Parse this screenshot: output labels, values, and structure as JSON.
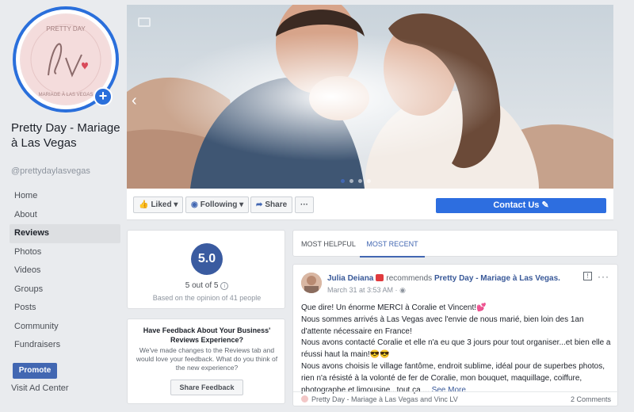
{
  "page": {
    "name": "Pretty Day - Mariage à Las Vegas",
    "handle": "@prettydaylasvegas",
    "logo_text": {
      "top": "PRETTY DAY",
      "monogram": "LV",
      "bottom": "MARIAGE À LAS VEGAS"
    }
  },
  "sidebar": {
    "items": [
      {
        "label": "Home"
      },
      {
        "label": "About"
      },
      {
        "label": "Reviews",
        "active": true
      },
      {
        "label": "Photos"
      },
      {
        "label": "Videos"
      },
      {
        "label": "Groups"
      },
      {
        "label": "Posts"
      },
      {
        "label": "Community"
      },
      {
        "label": "Fundraisers"
      }
    ],
    "promote_label": "Promote",
    "visit_ad_center": "Visit Ad Center"
  },
  "actions": {
    "liked": "Liked",
    "following": "Following",
    "share": "Share",
    "more": "···",
    "contact": "Contact Us"
  },
  "rating": {
    "score": "5.0",
    "out_of": "5 out of 5",
    "basis": "Based on the opinion of 41 people"
  },
  "feedback": {
    "title": "Have Feedback About Your Business' Reviews Experience?",
    "body": "We've made changes to the Reviews tab and would love your feedback. What do you think of the new experience?",
    "button": "Share Feedback"
  },
  "tabs": [
    {
      "label": "MOST HELPFUL",
      "active": false
    },
    {
      "label": "MOST RECENT",
      "active": true
    }
  ],
  "review": {
    "author": "Julia Deiana",
    "verb": "recommends",
    "target": "Pretty Day - Mariage à Las Vegas.",
    "time": "March 31 at 3:53 AM ·",
    "lines": [
      "Que dire! Un énorme MERCI à Coralie et Vincent!💕",
      "Nous sommes arrivés à Las Vegas avec l'envie de nous marié, bien loin des 1an d'attente nécessaire en France!",
      "Nous avons contacté Coralie et elle n'a eu que 3 jours pour tout organiser...et bien elle a réussi haut la main!😎😎",
      "Nous avons choisis le village fantôme, endroit sublime, idéal pour de superbes photos, rien n'a résisté à la volonté de fer de Coralie, mon bouquet, maquillage, coiffure, photographe et limousine...tout ça ..."
    ],
    "see_more": "See More",
    "footer_source": "Pretty Day - Mariage à Las Vegas and Vinc LV",
    "comments": "2 Comments"
  },
  "colors": {
    "facebook_blue": "#4267b2",
    "contact_blue": "#2d6ee0",
    "rating_circle": "#3a5ba0",
    "profile_ring": "#2a6fdb"
  }
}
